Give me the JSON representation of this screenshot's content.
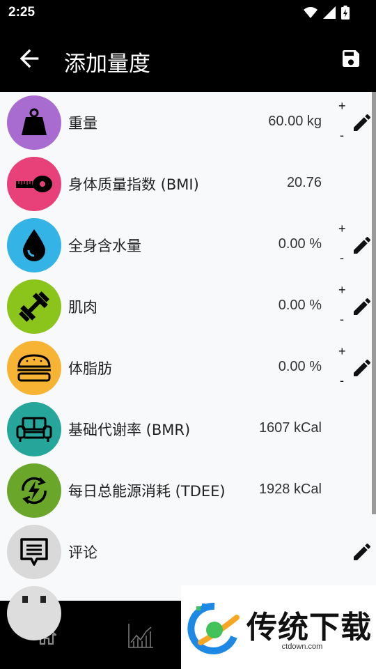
{
  "status_bar": {
    "time": "2:25",
    "icons": [
      "wifi-icon",
      "signal-icon",
      "battery-charging-icon"
    ]
  },
  "app_bar": {
    "title": "添加量度",
    "back_icon": "arrow-back-icon",
    "save_icon": "save-icon"
  },
  "rows": [
    {
      "label": "重量",
      "value": "60.00 kg",
      "color": "#a86bcf",
      "icon": "weight-icon",
      "stepper": true,
      "editable": true,
      "plus": "+",
      "minus": "-"
    },
    {
      "label": "身体质量指数 (BMI)",
      "value": "20.76",
      "color": "#e8417a",
      "icon": "tape-measure-icon",
      "stepper": false,
      "editable": false
    },
    {
      "label": "全身含水量",
      "value": "0.00 %",
      "color": "#33b3e6",
      "icon": "water-drop-icon",
      "stepper": true,
      "editable": true,
      "plus": "+",
      "minus": "-"
    },
    {
      "label": "肌肉",
      "value": "0.00 %",
      "color": "#8bc41b",
      "icon": "dumbbell-icon",
      "stepper": true,
      "editable": true,
      "plus": "+",
      "minus": "-"
    },
    {
      "label": "体脂肪",
      "value": "0.00 %",
      "color": "#f7b334",
      "icon": "burger-icon",
      "stepper": true,
      "editable": true,
      "plus": "+",
      "minus": "-"
    },
    {
      "label": "基础代谢率 (BMR)",
      "value": "1607 kCal",
      "color": "#26a69a",
      "icon": "sofa-icon",
      "stepper": false,
      "editable": false
    },
    {
      "label": "每日总能源消耗 (TDEE)",
      "value": "1928 kCal",
      "color": "#6aa629",
      "icon": "energy-bolt-icon",
      "stepper": false,
      "editable": false
    },
    {
      "label": "评论",
      "value": "",
      "color": "#d9d9d9",
      "icon": "comment-icon",
      "stepper": false,
      "editable": true
    }
  ],
  "bottom_nav": {
    "items": [
      "home-icon",
      "chart-icon"
    ]
  },
  "watermark": {
    "text": "传统下载",
    "domain": "ctdown.com"
  }
}
